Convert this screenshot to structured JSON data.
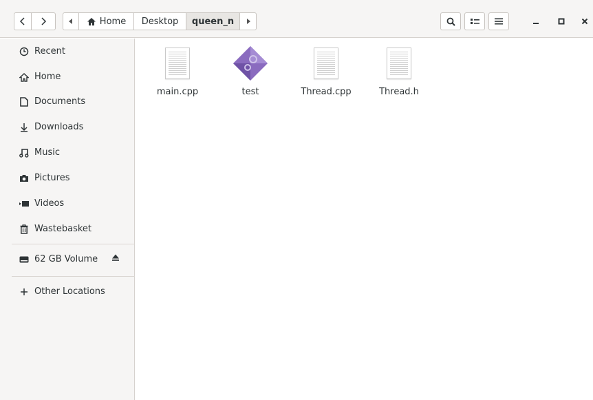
{
  "window": {
    "path": [
      {
        "label": "Home"
      },
      {
        "label": "Desktop"
      },
      {
        "label": "queen_n"
      }
    ]
  },
  "sidebar": {
    "items": [
      {
        "label": "Recent",
        "icon": "clock-icon"
      },
      {
        "label": "Home",
        "icon": "home-icon"
      },
      {
        "label": "Documents",
        "icon": "document-icon"
      },
      {
        "label": "Downloads",
        "icon": "download-icon"
      },
      {
        "label": "Music",
        "icon": "music-icon"
      },
      {
        "label": "Pictures",
        "icon": "camera-icon"
      },
      {
        "label": "Videos",
        "icon": "video-icon"
      },
      {
        "label": "Wastebasket",
        "icon": "trash-icon"
      }
    ],
    "volume": {
      "label": "62 GB Volume",
      "icon": "drive-icon",
      "action_icon": "eject-icon"
    },
    "other": {
      "label": "Other Locations",
      "icon": "plus-icon"
    }
  },
  "files": [
    {
      "name": "main.cpp",
      "icon": "text-file-icon"
    },
    {
      "name": "test",
      "icon": "executable-icon"
    },
    {
      "name": "Thread.cpp",
      "icon": "text-file-icon"
    },
    {
      "name": "Thread.h",
      "icon": "text-file-icon"
    }
  ],
  "colors": {
    "accent_purple": "#8a6bbf",
    "text": "#2e3436",
    "sidebar_bg": "#f6f5f4"
  }
}
